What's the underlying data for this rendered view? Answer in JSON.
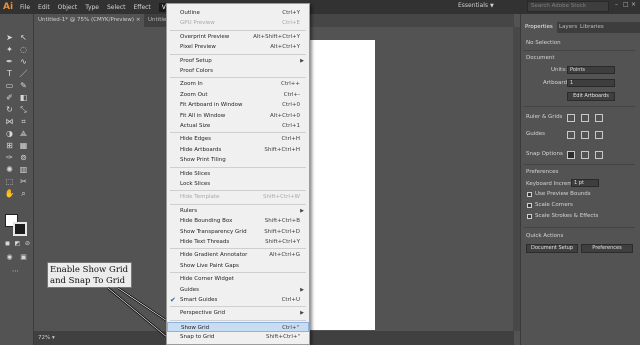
{
  "app": {
    "logo": "Ai"
  },
  "menubar": {
    "items": [
      "File",
      "Edit",
      "Object",
      "Type",
      "Select",
      "Effect",
      "View"
    ],
    "workspace": "Essentials",
    "search_placeholder": "Search Adobe Stock",
    "window_controls": [
      "–",
      "□",
      "×"
    ]
  },
  "tabs": [
    {
      "label": "Untitled-1* @ 75% (CMYK/Preview)"
    },
    {
      "label": "Untitle"
    }
  ],
  "zoom": "72%",
  "callout": {
    "line1": "Enable Show Grid",
    "line2": "and Snap To Grid"
  },
  "view_menu": [
    {
      "label": "Outline",
      "shortcut": "Ctrl+Y"
    },
    {
      "label": "GPU Preview",
      "shortcut": "Ctrl+E",
      "disabled": true
    },
    {
      "sep": true
    },
    {
      "label": "Overprint Preview",
      "shortcut": "Alt+Shift+Ctrl+Y"
    },
    {
      "label": "Pixel Preview",
      "shortcut": "Alt+Ctrl+Y"
    },
    {
      "sep": true
    },
    {
      "label": "Proof Setup",
      "submenu": true
    },
    {
      "label": "Proof Colors"
    },
    {
      "sep": true
    },
    {
      "label": "Zoom In",
      "shortcut": "Ctrl++"
    },
    {
      "label": "Zoom Out",
      "shortcut": "Ctrl+-"
    },
    {
      "label": "Fit Artboard in Window",
      "shortcut": "Ctrl+0"
    },
    {
      "label": "Fit All in Window",
      "shortcut": "Alt+Ctrl+0"
    },
    {
      "label": "Actual Size",
      "shortcut": "Ctrl+1"
    },
    {
      "sep": true
    },
    {
      "label": "Hide Edges",
      "shortcut": "Ctrl+H"
    },
    {
      "label": "Hide Artboards",
      "shortcut": "Shift+Ctrl+H"
    },
    {
      "label": "Show Print Tiling"
    },
    {
      "sep": true
    },
    {
      "label": "Hide Slices"
    },
    {
      "label": "Lock Slices"
    },
    {
      "sep": true
    },
    {
      "label": "Hide Template",
      "shortcut": "Shift+Ctrl+W",
      "disabled": true
    },
    {
      "sep": true
    },
    {
      "label": "Rulers",
      "submenu": true
    },
    {
      "label": "Hide Bounding Box",
      "shortcut": "Shift+Ctrl+B"
    },
    {
      "label": "Show Transparency Grid",
      "shortcut": "Shift+Ctrl+D"
    },
    {
      "label": "Hide Text Threads",
      "shortcut": "Shift+Ctrl+Y"
    },
    {
      "sep": true
    },
    {
      "label": "Hide Gradient Annotator",
      "shortcut": "Alt+Ctrl+G"
    },
    {
      "label": "Show Live Paint Gaps"
    },
    {
      "sep": true
    },
    {
      "label": "Hide Corner Widget"
    },
    {
      "label": "Guides",
      "submenu": true
    },
    {
      "label": "Smart Guides",
      "shortcut": "Ctrl+U",
      "checked": true
    },
    {
      "sep": true
    },
    {
      "label": "Perspective Grid",
      "submenu": true
    },
    {
      "sep": true
    },
    {
      "label": "Show Grid",
      "shortcut": "Ctrl+\"",
      "highlighted": true
    },
    {
      "label": "Snap to Grid",
      "shortcut": "Shift+Ctrl+\""
    }
  ],
  "panel": {
    "tabs": [
      "Properties",
      "Layers",
      "Libraries"
    ],
    "no_selection": "No Selection",
    "document_heading": "Document",
    "units_label": "Units:",
    "units_value": "Points",
    "artboard_label": "Artboard:",
    "artboard_value": "1",
    "edit_artboards": "Edit Artboards",
    "rulers_grids": "Ruler & Grids",
    "guides": "Guides",
    "snap_options": "Snap Options",
    "preferences_heading": "Preferences",
    "keyboard_increment_label": "Keyboard Increment:",
    "keyboard_increment_value": "1 pt",
    "use_preview_bounds": "Use Preview Bounds",
    "scale_corners": "Scale Corners",
    "scale_strokes": "Scale Strokes & Effects",
    "quick_actions": "Quick Actions",
    "document_setup": "Document Setup",
    "preferences_btn": "Preferences"
  }
}
